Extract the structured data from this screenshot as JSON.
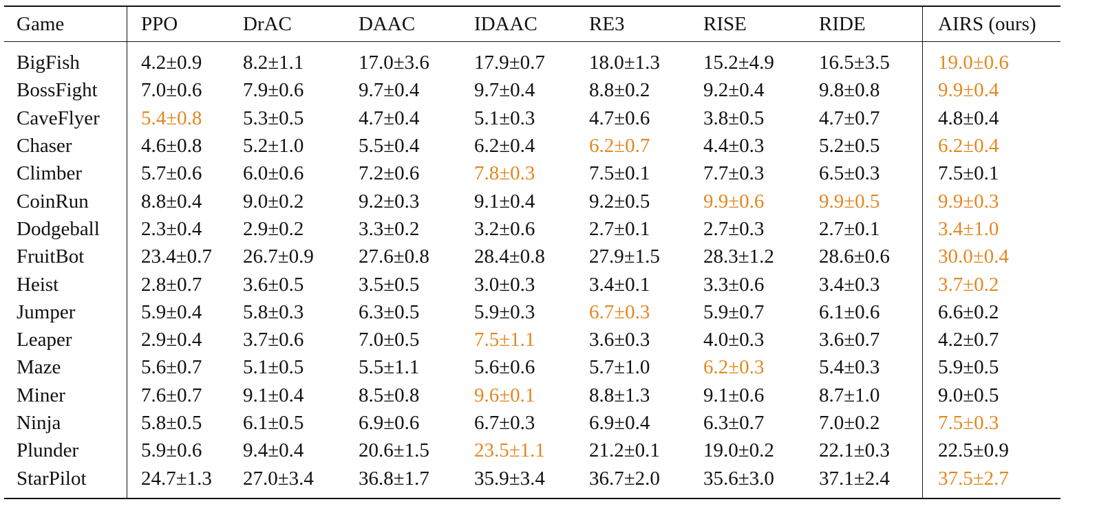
{
  "table": {
    "columns": [
      "Game",
      "PPO",
      "DrAC",
      "DAAC",
      "IDAAC",
      "RE3",
      "RISE",
      "RIDE",
      "AIRS (ours)"
    ],
    "highlight_color": "#e3871f",
    "rows": [
      {
        "game": "BigFish",
        "values": [
          "4.2±0.9",
          "8.2±1.1",
          "17.0±3.6",
          "17.9±0.7",
          "18.0±1.3",
          "15.2±4.9",
          "16.5±3.5",
          "19.0±0.6"
        ],
        "best": [
          7
        ]
      },
      {
        "game": "BossFight",
        "values": [
          "7.0±0.6",
          "7.9±0.6",
          "9.7±0.4",
          "9.7±0.4",
          "8.8±0.2",
          "9.2±0.4",
          "9.8±0.8",
          "9.9±0.4"
        ],
        "best": [
          7
        ]
      },
      {
        "game": "CaveFlyer",
        "values": [
          "5.4±0.8",
          "5.3±0.5",
          "4.7±0.4",
          "5.1±0.3",
          "4.7±0.6",
          "3.8±0.5",
          "4.7±0.7",
          "4.8±0.4"
        ],
        "best": [
          0
        ]
      },
      {
        "game": "Chaser",
        "values": [
          "4.6±0.8",
          "5.2±1.0",
          "5.5±0.4",
          "6.2±0.4",
          "6.2±0.7",
          "4.4±0.3",
          "5.2±0.5",
          "6.2±0.4"
        ],
        "best": [
          4,
          7
        ]
      },
      {
        "game": "Climber",
        "values": [
          "5.7±0.6",
          "6.0±0.6",
          "7.2±0.6",
          "7.8±0.3",
          "7.5±0.1",
          "7.7±0.3",
          "6.5±0.3",
          "7.5±0.1"
        ],
        "best": [
          3
        ]
      },
      {
        "game": "CoinRun",
        "values": [
          "8.8±0.4",
          "9.0±0.2",
          "9.2±0.3",
          "9.1±0.4",
          "9.2±0.5",
          "9.9±0.6",
          "9.9±0.5",
          "9.9±0.3"
        ],
        "best": [
          5,
          6,
          7
        ]
      },
      {
        "game": "Dodgeball",
        "values": [
          "2.3±0.4",
          "2.9±0.2",
          "3.3±0.2",
          "3.2±0.6",
          "2.7±0.1",
          "2.7±0.3",
          "2.7±0.1",
          "3.4±1.0"
        ],
        "best": [
          7
        ]
      },
      {
        "game": "FruitBot",
        "values": [
          "23.4±0.7",
          "26.7±0.9",
          "27.6±0.8",
          "28.4±0.8",
          "27.9±1.5",
          "28.3±1.2",
          "28.6±0.6",
          "30.0±0.4"
        ],
        "best": [
          7
        ]
      },
      {
        "game": "Heist",
        "values": [
          "2.8±0.7",
          "3.6±0.5",
          "3.5±0.5",
          "3.0±0.3",
          "3.4±0.1",
          "3.3±0.6",
          "3.4±0.3",
          "3.7±0.2"
        ],
        "best": [
          7
        ]
      },
      {
        "game": "Jumper",
        "values": [
          "5.9±0.4",
          "5.8±0.3",
          "6.3±0.5",
          "5.9±0.3",
          "6.7±0.3",
          "5.9±0.7",
          "6.1±0.6",
          "6.6±0.2"
        ],
        "best": [
          4
        ]
      },
      {
        "game": "Leaper",
        "values": [
          "2.9±0.4",
          "3.7±0.6",
          "7.0±0.5",
          "7.5±1.1",
          "3.6±0.3",
          "4.0±0.3",
          "3.6±0.7",
          "4.2±0.7"
        ],
        "best": [
          3
        ]
      },
      {
        "game": "Maze",
        "values": [
          "5.6±0.7",
          "5.1±0.5",
          "5.5±1.1",
          "5.6±0.6",
          "5.7±1.0",
          "6.2±0.3",
          "5.4±0.3",
          "5.9±0.5"
        ],
        "best": [
          5
        ]
      },
      {
        "game": "Miner",
        "values": [
          "7.6±0.7",
          "9.1±0.4",
          "8.5±0.8",
          "9.6±0.1",
          "8.8±1.3",
          "9.1±0.6",
          "8.7±1.0",
          "9.0±0.5"
        ],
        "best": [
          3
        ]
      },
      {
        "game": "Ninja",
        "values": [
          "5.8±0.5",
          "6.1±0.5",
          "6.9±0.6",
          "6.7±0.3",
          "6.9±0.4",
          "6.3±0.7",
          "7.0±0.2",
          "7.5±0.3"
        ],
        "best": [
          7
        ]
      },
      {
        "game": "Plunder",
        "values": [
          "5.9±0.6",
          "9.4±0.4",
          "20.6±1.5",
          "23.5±1.1",
          "21.2±0.1",
          "19.0±0.2",
          "22.1±0.3",
          "22.5±0.9"
        ],
        "best": [
          3
        ]
      },
      {
        "game": "StarPilot",
        "values": [
          "24.7±1.3",
          "27.0±3.4",
          "36.8±1.7",
          "35.9±3.4",
          "36.7±2.0",
          "35.6±3.0",
          "37.1±2.4",
          "37.5±2.7"
        ],
        "best": [
          7
        ]
      }
    ]
  }
}
